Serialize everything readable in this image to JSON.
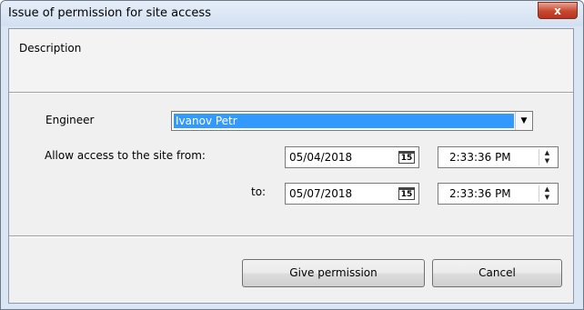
{
  "window": {
    "title": "Issue of permission for site access",
    "close_label": "x"
  },
  "description_label": "Description",
  "engineer": {
    "label": "Engineer",
    "selected": "Ivanov Petr",
    "dropdown_glyph": "▼"
  },
  "access": {
    "from_label": "Allow access to the site from:",
    "to_label": "to:",
    "from_date": "05/04/2018",
    "from_time": "2:33:36 PM",
    "to_date": "05/07/2018",
    "to_time": "2:33:36 PM",
    "calendar_icon_text": "15"
  },
  "buttons": {
    "give_permission": "Give permission",
    "cancel": "Cancel"
  }
}
